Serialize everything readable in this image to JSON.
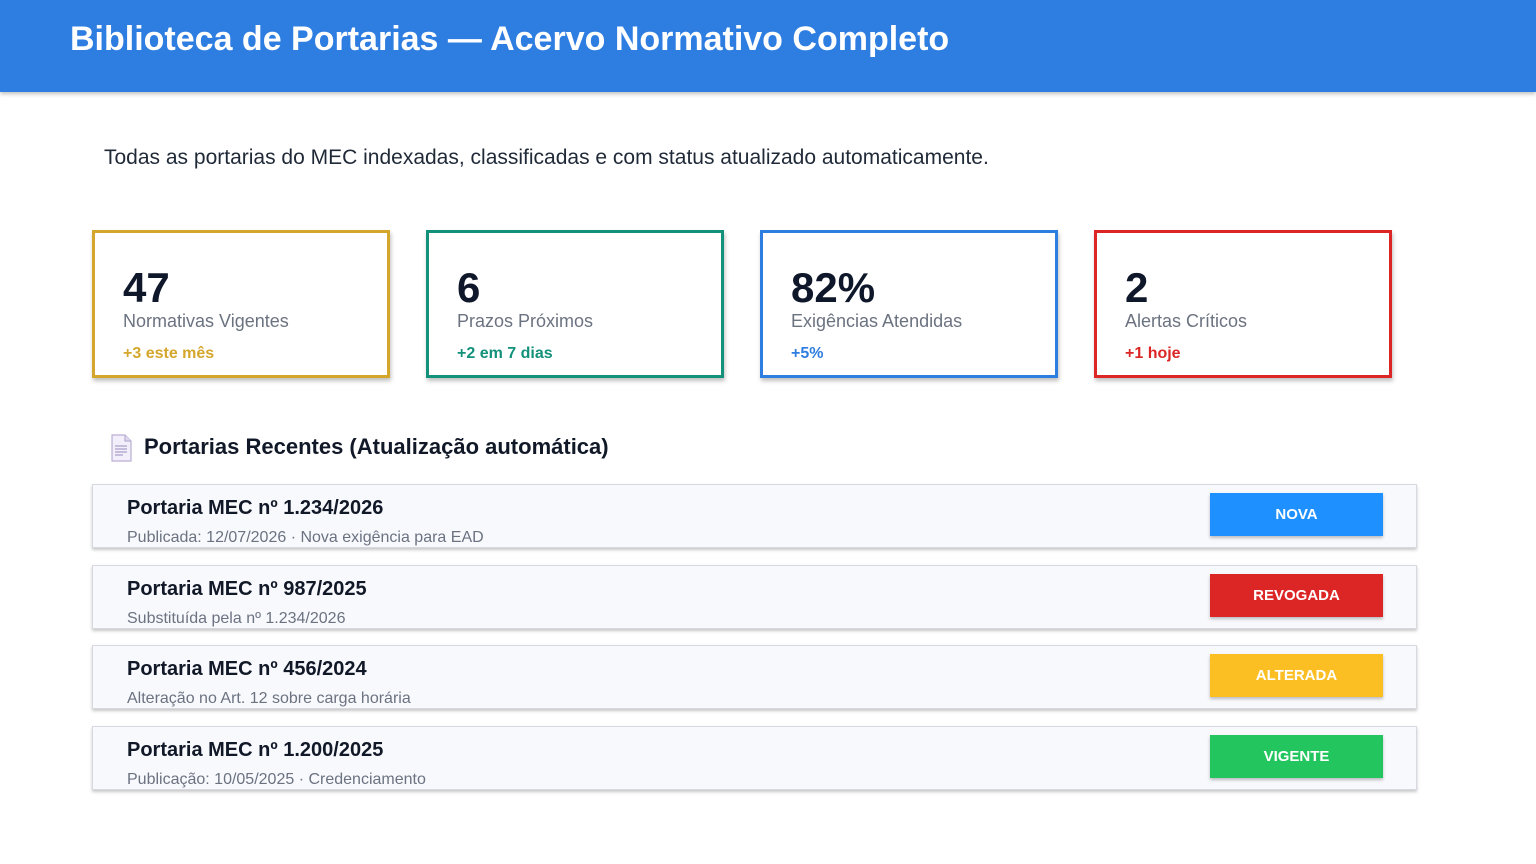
{
  "header": {
    "title": "Biblioteca de Portarias — Acervo Normativo Completo",
    "bg_color": "#2e7de1"
  },
  "subtitle": "Todas as portarias do MEC indexadas, classificadas e com status atualizado automaticamente.",
  "stats": [
    {
      "value": "47",
      "label": "Normativas Vigentes",
      "delta": "+3 este mês",
      "color": "#d4a72c"
    },
    {
      "value": "6",
      "label": "Prazos Próximos",
      "delta": "+2 em 7 dias",
      "color": "#12917b"
    },
    {
      "value": "82%",
      "label": "Exigências Atendidas",
      "delta": "+5%",
      "color": "#2e7de1"
    },
    {
      "value": "2",
      "label": "Alertas Críticos",
      "delta": "+1 hoje",
      "color": "#dc2626"
    }
  ],
  "section": {
    "icon": "document-icon",
    "title": "Portarias Recentes (Atualização automática)"
  },
  "portarias": [
    {
      "title": "Portaria MEC nº 1.234/2026",
      "desc": "Publicada: 12/07/2026 · Nova exigência para EAD",
      "status": "NOVA",
      "status_color": "#1e90ff"
    },
    {
      "title": "Portaria MEC nº 987/2025",
      "desc": "Substituída pela nº 1.234/2026",
      "status": "REVOGADA",
      "status_color": "#dc2626"
    },
    {
      "title": "Portaria MEC nº 456/2024",
      "desc": "Alteração no Art. 12 sobre carga horária",
      "status": "ALTERADA",
      "status_color": "#fbbf24"
    },
    {
      "title": "Portaria MEC nº 1.200/2025",
      "desc": "Publicação: 10/05/2025 · Credenciamento",
      "status": "VIGENTE",
      "status_color": "#22c55e"
    }
  ]
}
